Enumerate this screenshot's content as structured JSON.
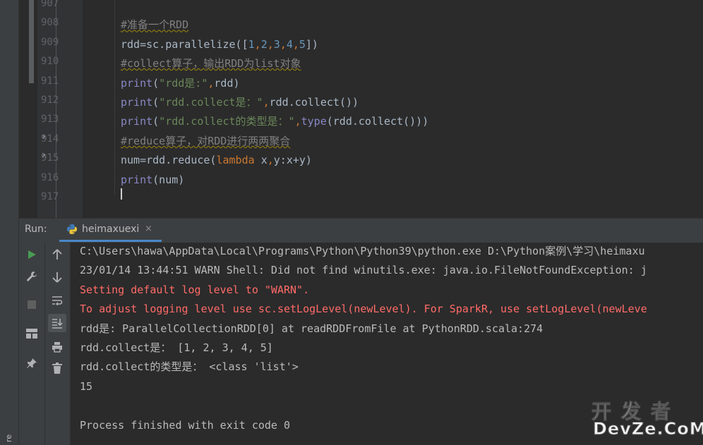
{
  "editor": {
    "line_numbers": [
      "907",
      "908",
      "909",
      "910",
      "911",
      "912",
      "913",
      "914",
      "915",
      "916",
      "917"
    ],
    "lines": [
      [
        {
          "t": "",
          "c": "c-def"
        }
      ],
      [
        {
          "t": "#准备一个RDD",
          "c": "c-comment"
        }
      ],
      [
        {
          "t": "rdd=sc.parallelize([",
          "c": "c-def"
        },
        {
          "t": "1",
          "c": "c-num"
        },
        {
          "t": ",",
          "c": "c-kw"
        },
        {
          "t": "2",
          "c": "c-num"
        },
        {
          "t": ",",
          "c": "c-kw"
        },
        {
          "t": "3",
          "c": "c-num"
        },
        {
          "t": ",",
          "c": "c-kw"
        },
        {
          "t": "4",
          "c": "c-num"
        },
        {
          "t": ",",
          "c": "c-kw"
        },
        {
          "t": "5",
          "c": "c-num"
        },
        {
          "t": "])",
          "c": "c-def"
        }
      ],
      [
        {
          "t": "#collect算子，输出RDD为list对象",
          "c": "c-comment"
        }
      ],
      [
        {
          "t": "print",
          "c": "c-builtin"
        },
        {
          "t": "(",
          "c": "c-def"
        },
        {
          "t": "\"rdd是:\"",
          "c": "c-str"
        },
        {
          "t": ",",
          "c": "c-kw"
        },
        {
          "t": "rdd)",
          "c": "c-def"
        }
      ],
      [
        {
          "t": "print",
          "c": "c-builtin"
        },
        {
          "t": "(",
          "c": "c-def"
        },
        {
          "t": "\"rdd.collect是：\"",
          "c": "c-str"
        },
        {
          "t": ",",
          "c": "c-kw"
        },
        {
          "t": "rdd.collect())",
          "c": "c-def"
        }
      ],
      [
        {
          "t": "print",
          "c": "c-builtin"
        },
        {
          "t": "(",
          "c": "c-def"
        },
        {
          "t": "\"rdd.collect的类型是：\"",
          "c": "c-str"
        },
        {
          "t": ",",
          "c": "c-kw"
        },
        {
          "t": "type",
          "c": "c-builtin"
        },
        {
          "t": "(rdd.collect()))",
          "c": "c-def"
        }
      ],
      [
        {
          "t": "#reduce算子，对RDD进行两两聚合",
          "c": "c-comment"
        }
      ],
      [
        {
          "t": "num=rdd.reduce(",
          "c": "c-def"
        },
        {
          "t": "lambda ",
          "c": "c-kw"
        },
        {
          "t": "x",
          "c": "c-def"
        },
        {
          "t": ",",
          "c": "c-kw"
        },
        {
          "t": "y",
          "c": "c-def"
        },
        {
          "t": ":",
          "c": "c-def"
        },
        {
          "t": "x+y)",
          "c": "c-def"
        }
      ],
      [
        {
          "t": "print",
          "c": "c-builtin"
        },
        {
          "t": "(num)",
          "c": "c-def"
        }
      ],
      [
        {
          "t": "",
          "c": "c-def"
        }
      ]
    ]
  },
  "run_panel": {
    "title": "Run:",
    "tab_label": "heimaxuexi",
    "tab_close": "×"
  },
  "left_strip_text": "re",
  "console": {
    "lines": [
      {
        "text": "C:\\Users\\hawa\\AppData\\Local\\Programs\\Python\\Python39\\python.exe D:\\Python案例\\学习\\heimaxu",
        "err": false
      },
      {
        "text": "23/01/14 13:44:51 WARN Shell: Did not find winutils.exe: java.io.FileNotFoundException: j",
        "err": false
      },
      {
        "text": "Setting default log level to \"WARN\".",
        "err": true
      },
      {
        "text": "To adjust logging level use sc.setLogLevel(newLevel). For SparkR, use setLogLevel(newLeve",
        "err": true
      },
      {
        "text": "rdd是: ParallelCollectionRDD[0] at readRDDFromFile at PythonRDD.scala:274",
        "err": false
      },
      {
        "text": "rdd.collect是： [1, 2, 3, 4, 5]",
        "err": false
      },
      {
        "text": "rdd.collect的类型是： <class 'list'>",
        "err": false
      },
      {
        "text": "15",
        "err": false
      },
      {
        "text": "",
        "err": false
      },
      {
        "text": "Process finished with exit code 0",
        "err": false
      }
    ]
  },
  "watermark": {
    "chinese": "开发者",
    "english": "DevZe.CoM"
  },
  "icons": {
    "col1": [
      "run-icon",
      "wrench-icon",
      "stop-icon",
      "layout-icon",
      "pin-icon"
    ],
    "col2": [
      "arrow-up-icon",
      "arrow-down-icon",
      "soft-wrap-icon",
      "scroll-to-end-icon",
      "print-icon",
      "trash-icon"
    ],
    "fold": [
      "fold-arrow-icon",
      "fold-arrow-icon"
    ]
  },
  "colors": {
    "background": "#2b2b2b",
    "panel": "#3c3f41",
    "error_text": "#ff6b68",
    "comment": "#808080",
    "string": "#6a8759",
    "keyword": "#cc7832",
    "number": "#6897bb",
    "run_green": "#499c54",
    "tab_underline": "#4a88c7"
  }
}
